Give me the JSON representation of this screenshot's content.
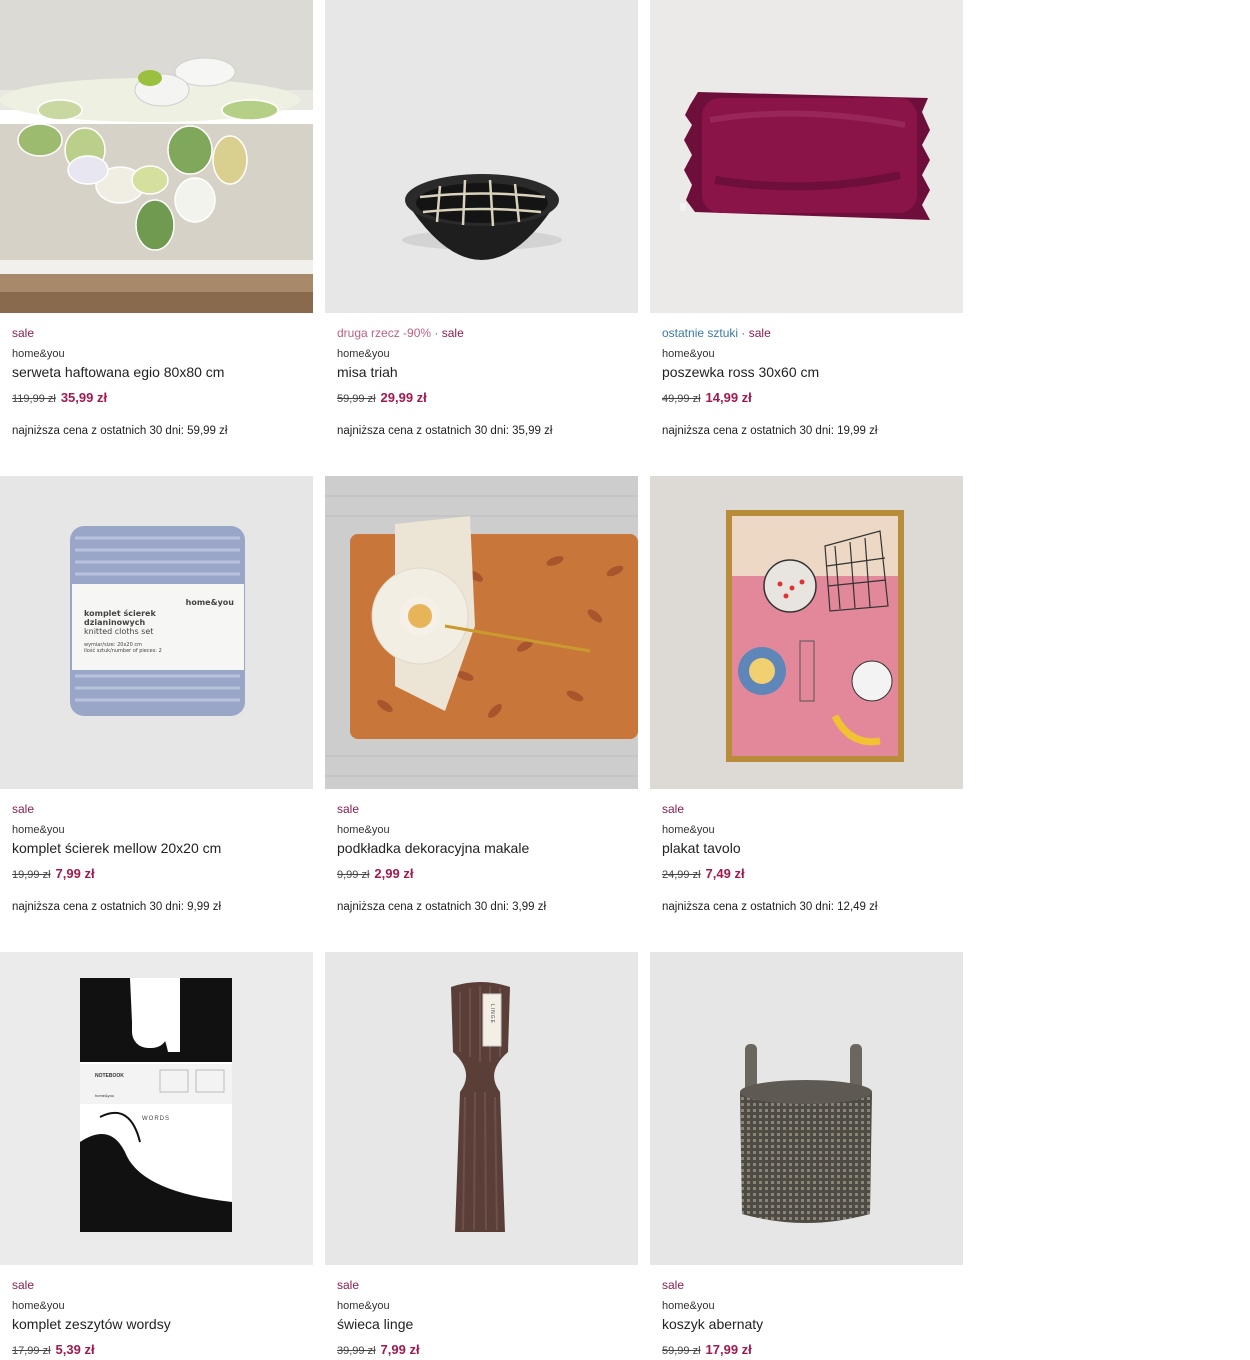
{
  "products": [
    {
      "tags": [
        {
          "text": "sale",
          "type": "sale"
        }
      ],
      "brand": "home&you",
      "name": "serweta haftowana egio 80x80 cm",
      "old_price": "119,99 zł",
      "new_price": "35,99 zł",
      "lowest_price": "najniższa cena z ostatnich 30 dni: 59,99 zł"
    },
    {
      "tags": [
        {
          "text": "druga rzecz -90%",
          "type": "promo"
        },
        {
          "text": "sale",
          "type": "sale"
        }
      ],
      "brand": "home&you",
      "name": "misa triah",
      "old_price": "59,99 zł",
      "new_price": "29,99 zł",
      "lowest_price": "najniższa cena z ostatnich 30 dni: 35,99 zł"
    },
    {
      "tags": [
        {
          "text": "ostatnie sztuki",
          "type": "last"
        },
        {
          "text": "sale",
          "type": "sale"
        }
      ],
      "brand": "home&you",
      "name": "poszewka ross 30x60 cm",
      "old_price": "49,99 zł",
      "new_price": "14,99 zł",
      "lowest_price": "najniższa cena z ostatnich 30 dni: 19,99 zł"
    },
    {
      "tags": [
        {
          "text": "sale",
          "type": "sale"
        }
      ],
      "brand": "home&you",
      "name": "komplet ścierek mellow 20x20 cm",
      "old_price": "19,99 zł",
      "new_price": "7,99 zł",
      "lowest_price": "najniższa cena z ostatnich 30 dni: 9,99 zł"
    },
    {
      "tags": [
        {
          "text": "sale",
          "type": "sale"
        }
      ],
      "brand": "home&you",
      "name": "podkładka dekoracyjna makale",
      "old_price": "9,99 zł",
      "new_price": "2,99 zł",
      "lowest_price": "najniższa cena z ostatnich 30 dni: 3,99 zł"
    },
    {
      "tags": [
        {
          "text": "sale",
          "type": "sale"
        }
      ],
      "brand": "home&you",
      "name": "plakat tavolo",
      "old_price": "24,99 zł",
      "new_price": "7,49 zł",
      "lowest_price": "najniższa cena z ostatnich 30 dni: 12,49 zł"
    },
    {
      "tags": [
        {
          "text": "sale",
          "type": "sale"
        }
      ],
      "brand": "home&you",
      "name": "komplet zeszytów wordsy",
      "old_price": "17,99 zł",
      "new_price": "5,39 zł",
      "lowest_price": ""
    },
    {
      "tags": [
        {
          "text": "sale",
          "type": "sale"
        }
      ],
      "brand": "home&you",
      "name": "świeca linge",
      "old_price": "39,99 zł",
      "new_price": "7,99 zł",
      "lowest_price": ""
    },
    {
      "tags": [
        {
          "text": "sale",
          "type": "sale"
        }
      ],
      "brand": "home&you",
      "name": "koszyk abernaty",
      "old_price": "59,99 zł",
      "new_price": "17,99 zł",
      "lowest_price": ""
    }
  ],
  "images": {
    "p0": {
      "packaging_text": ""
    },
    "p3": {
      "label_brand": "home&you",
      "label_line1": "komplet ścierek",
      "label_line2": "dzianinowych",
      "label_line3": "knitted cloths set",
      "label_line4": "wymiar/size: 20x20 cm",
      "label_line5": "ilość sztuk/number of pieces: 2"
    },
    "p6": {
      "notebook_title": "NOTEBOOK",
      "words_label": "WORDS",
      "brand": "home&you"
    },
    "p7": {
      "tag_text": "LINGE"
    }
  },
  "colors": {
    "sale": "#8e1d52",
    "promo": "#c0607e",
    "last": "#3b79a6",
    "price": "#a3194f"
  }
}
